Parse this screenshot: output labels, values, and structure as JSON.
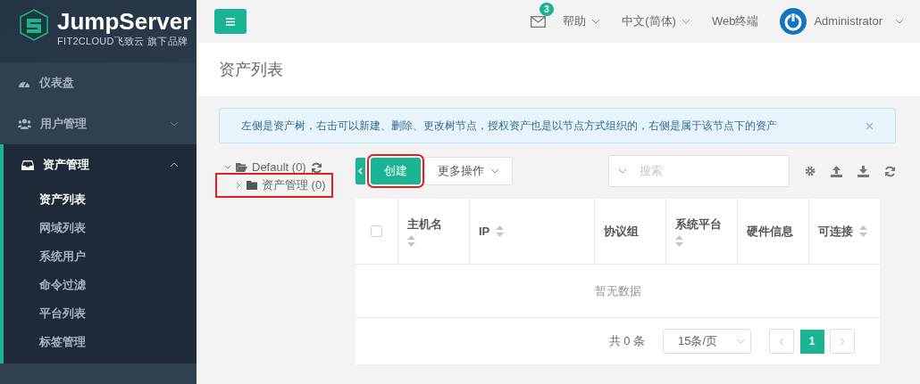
{
  "brand": {
    "name": "JumpServer",
    "tagline": "FIT2CLOUD飞致云 旗下品牌"
  },
  "sidebar": {
    "items": [
      {
        "label": "仪表盘",
        "kind": "dashboard",
        "selected": false
      },
      {
        "label": "用户管理",
        "kind": "users",
        "expanded": false,
        "selected": false
      },
      {
        "label": "资产管理",
        "kind": "assets",
        "expanded": true,
        "selected": true,
        "children": [
          {
            "label": "资产列表",
            "selected": true
          },
          {
            "label": "网域列表",
            "selected": false
          },
          {
            "label": "系统用户",
            "selected": false
          },
          {
            "label": "命令过滤",
            "selected": false
          },
          {
            "label": "平台列表",
            "selected": false
          },
          {
            "label": "标签管理",
            "selected": false
          }
        ]
      }
    ]
  },
  "topbar": {
    "mail_count": "3",
    "menus": [
      {
        "label": "帮助",
        "dropdown": true
      },
      {
        "label": "中文(简体)",
        "dropdown": true
      },
      {
        "label": "Web终端",
        "dropdown": false
      }
    ],
    "user": "Administrator"
  },
  "page_title": "资产列表",
  "notice": "左侧是资产树，右击可以新建、删除、更改树节点，授权资产也是以节点方式组织的，右侧是属于该节点下的资产",
  "tree": {
    "label": "Default (0)",
    "expanded": true,
    "children": [
      {
        "label": "资产管理 (0)",
        "expanded": false,
        "highlighted": true
      }
    ]
  },
  "toolbar": {
    "create": {
      "label": "创建",
      "highlighted": true
    },
    "more": "更多操作",
    "search": {
      "placeholder": "搜索"
    }
  },
  "table": {
    "select_all": {
      "checked": false
    },
    "columns": [
      {
        "label": "主机名",
        "sortable": true
      },
      {
        "label": "IP",
        "sortable": true
      },
      {
        "label": "协议组",
        "sortable": false
      },
      {
        "label": "系统平台",
        "sortable": true
      },
      {
        "label": "硬件信息",
        "sortable": false
      },
      {
        "label": "可连接",
        "sortable": true
      }
    ],
    "empty_text": "暂无数据"
  },
  "pagination": {
    "total": "共 0 条",
    "page_size": "15条/页",
    "pages": [
      {
        "label": "1",
        "selected": true
      }
    ]
  }
}
